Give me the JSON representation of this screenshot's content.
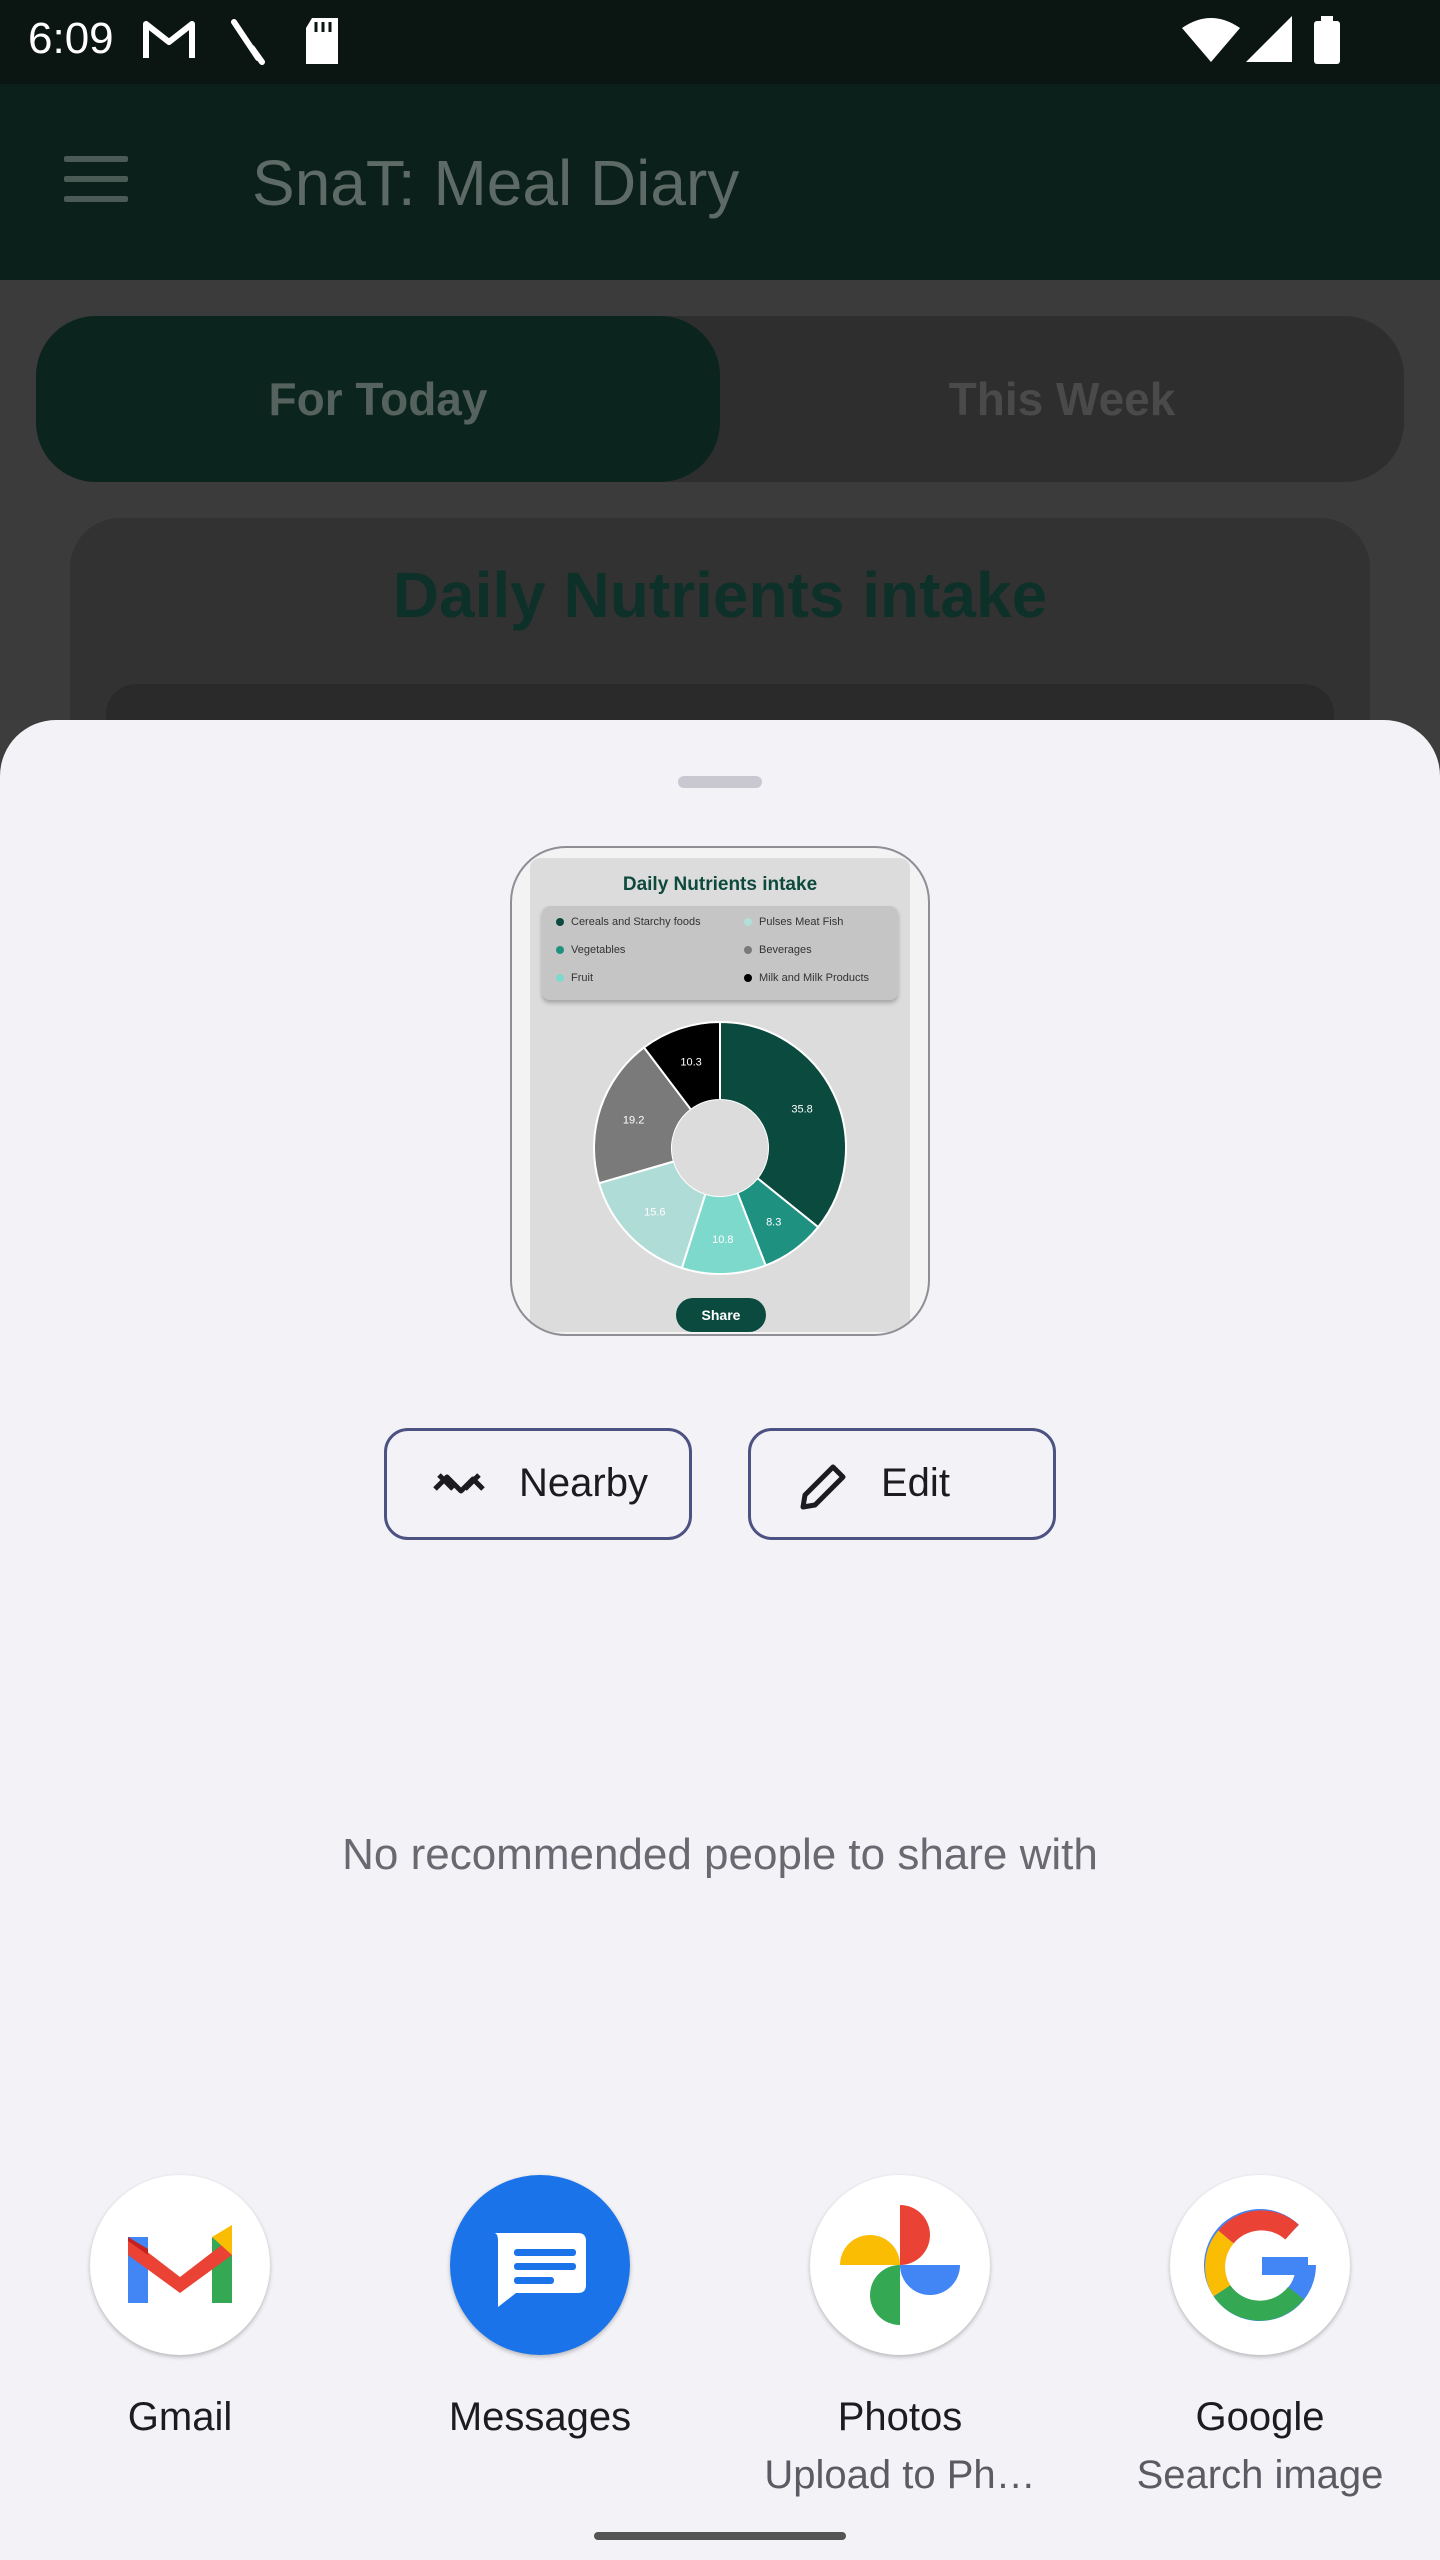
{
  "status_bar": {
    "time": "6:09",
    "icons": [
      "gmail-notification-icon",
      "pen-notification-icon",
      "sd-card-icon",
      "wifi-icon",
      "signal-icon",
      "battery-icon"
    ]
  },
  "app_bar": {
    "title": "SnaT: Meal Diary",
    "menu_icon": "hamburger-menu-icon"
  },
  "tabs": {
    "today": "For Today",
    "week": "This Week"
  },
  "card": {
    "title": "Daily Nutrients intake"
  },
  "share_sheet": {
    "preview": {
      "title": "Daily Nutrients intake",
      "legend": [
        {
          "label": "Cereals and Starchy foods",
          "color": "#0b4a3e"
        },
        {
          "label": "Pulses Meat Fish",
          "color": "#b0e0d9"
        },
        {
          "label": "Vegetables",
          "color": "#1f9181"
        },
        {
          "label": "Beverages",
          "color": "#7a7a7a"
        },
        {
          "label": "Fruit",
          "color": "#7dd9cc"
        },
        {
          "label": "Milk and Milk Products",
          "color": "#000000"
        }
      ],
      "share_label": "Share",
      "chart_data": {
        "type": "pie",
        "title": "Daily Nutrients intake",
        "slices": [
          {
            "label": "Cereals and Starchy foods",
            "value": 35.8,
            "color": "#0b4a3e"
          },
          {
            "label": "Vegetables",
            "value": 8.3,
            "color": "#1f9181"
          },
          {
            "label": "Fruit",
            "value": 10.8,
            "color": "#7dd9cc"
          },
          {
            "label": "Pulses Meat Fish",
            "value": 15.6,
            "color": "#b0dcd8"
          },
          {
            "label": "Beverages",
            "value": 19.2,
            "color": "#7a7a7a"
          },
          {
            "label": "Milk and Milk Products",
            "value": 10.3,
            "color": "#000000"
          }
        ],
        "legend": "top"
      }
    },
    "actions": {
      "nearby": "Nearby",
      "edit": "Edit"
    },
    "no_people_text": "No recommended people to share with",
    "apps": [
      {
        "name": "Gmail",
        "sub": "",
        "icon": "gmail-icon"
      },
      {
        "name": "Messages",
        "sub": "",
        "icon": "messages-icon"
      },
      {
        "name": "Photos",
        "sub": "Upload to Ph…",
        "icon": "photos-icon"
      },
      {
        "name": "Google",
        "sub": "Search image",
        "icon": "google-icon"
      }
    ]
  }
}
